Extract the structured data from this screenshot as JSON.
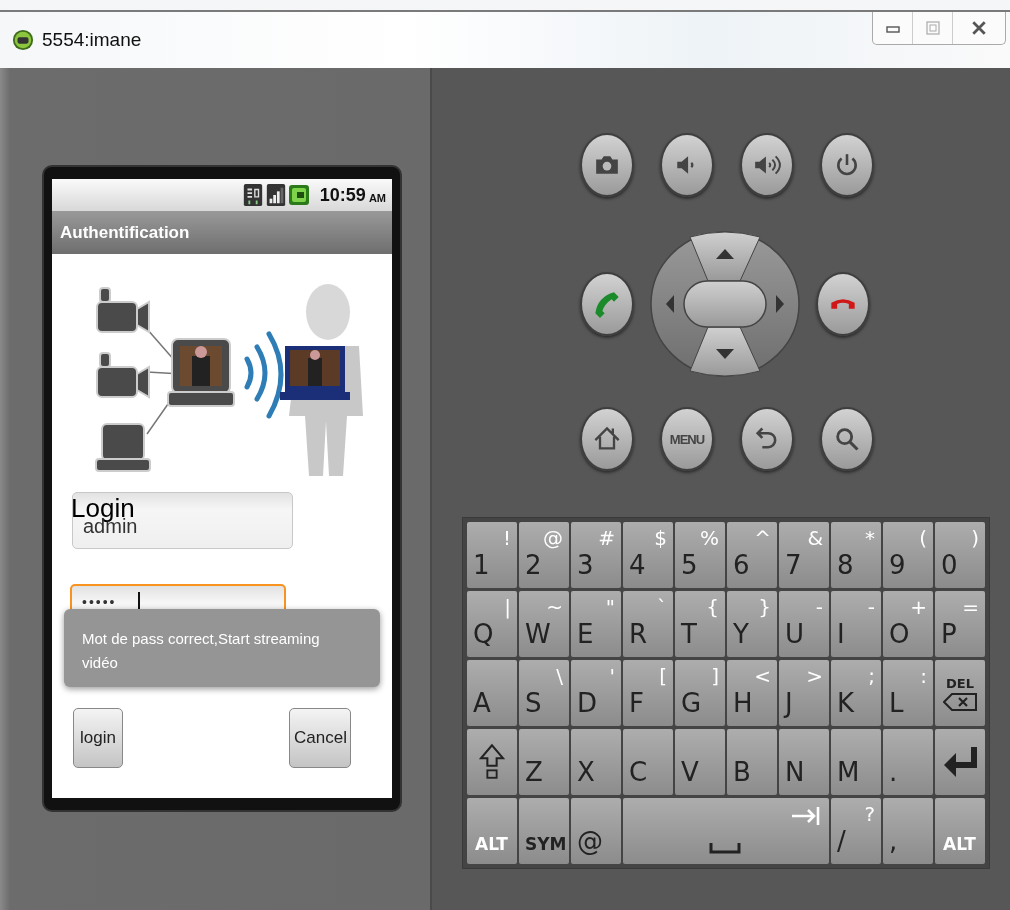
{
  "window": {
    "title": "5554:imane"
  },
  "phone": {
    "status_bar": {
      "time": "10:59",
      "period": "AM"
    },
    "app_bar": {
      "title": "Authentification"
    },
    "form": {
      "login_label": "Login",
      "username": {
        "value": "admin",
        "focused": false
      },
      "password": {
        "value": "•••••",
        "focused": true
      }
    },
    "toast": "Mot de pass correct,Start streaming vidéo",
    "buttons": [
      "login",
      "Cancel"
    ]
  },
  "hardware_buttons": [
    {
      "kind": "camera"
    },
    {
      "kind": "volume_down"
    },
    {
      "kind": "volume_up"
    },
    {
      "kind": "power"
    },
    {
      "kind": "call"
    },
    {
      "kind": "dpad"
    },
    {
      "kind": "end_call"
    },
    {
      "kind": "home"
    },
    {
      "kind": "menu",
      "label": "MENU"
    },
    {
      "kind": "back"
    },
    {
      "kind": "search"
    }
  ],
  "keyboard": [
    [
      {
        "kind": "char",
        "main": "1",
        "alt": "!"
      },
      {
        "kind": "char",
        "main": "2",
        "alt": "@"
      },
      {
        "kind": "char",
        "main": "3",
        "alt": "#"
      },
      {
        "kind": "char",
        "main": "4",
        "alt": "$"
      },
      {
        "kind": "char",
        "main": "5",
        "alt": "%"
      },
      {
        "kind": "char",
        "main": "6",
        "alt": "^"
      },
      {
        "kind": "char",
        "main": "7",
        "alt": "&"
      },
      {
        "kind": "char",
        "main": "8",
        "alt": "*"
      },
      {
        "kind": "char",
        "main": "9",
        "alt": "("
      },
      {
        "kind": "char",
        "main": "0",
        "alt": ")"
      }
    ],
    [
      {
        "kind": "char",
        "main": "Q",
        "alt": "|"
      },
      {
        "kind": "char",
        "main": "W",
        "alt": "~"
      },
      {
        "kind": "char",
        "main": "E",
        "alt": "\""
      },
      {
        "kind": "char",
        "main": "R",
        "alt": "`"
      },
      {
        "kind": "char",
        "main": "T",
        "alt": "{"
      },
      {
        "kind": "char",
        "main": "Y",
        "alt": "}"
      },
      {
        "kind": "char",
        "main": "U",
        "alt": "-"
      },
      {
        "kind": "char",
        "main": "I",
        "alt": "-"
      },
      {
        "kind": "char",
        "main": "O",
        "alt": "+"
      },
      {
        "kind": "char",
        "main": "P",
        "alt": "="
      }
    ],
    [
      {
        "kind": "char",
        "main": "A"
      },
      {
        "kind": "char",
        "main": "S",
        "alt": "\\"
      },
      {
        "kind": "char",
        "main": "D",
        "alt": "'"
      },
      {
        "kind": "char",
        "main": "F",
        "alt": "["
      },
      {
        "kind": "char",
        "main": "G",
        "alt": "]"
      },
      {
        "kind": "char",
        "main": "H",
        "alt": "<"
      },
      {
        "kind": "char",
        "main": "J",
        "alt": ">"
      },
      {
        "kind": "char",
        "main": "K",
        "alt": ";"
      },
      {
        "kind": "char",
        "main": "L",
        "alt": ":"
      },
      {
        "kind": "del",
        "label": "DEL"
      }
    ],
    [
      {
        "kind": "shift"
      },
      {
        "kind": "char",
        "main": "Z"
      },
      {
        "kind": "char",
        "main": "X"
      },
      {
        "kind": "char",
        "main": "C"
      },
      {
        "kind": "char",
        "main": "V"
      },
      {
        "kind": "char",
        "main": "B"
      },
      {
        "kind": "char",
        "main": "N"
      },
      {
        "kind": "char",
        "main": "M"
      },
      {
        "kind": "char",
        "main": "."
      },
      {
        "kind": "enter"
      }
    ],
    [
      {
        "kind": "alt",
        "label": "ALT"
      },
      {
        "kind": "sym",
        "label": "SYM"
      },
      {
        "kind": "char",
        "main": "@"
      },
      {
        "kind": "space"
      },
      {
        "kind": "char",
        "main": "/",
        "alt": "?"
      },
      {
        "kind": "char",
        "main": ","
      },
      {
        "kind": "alt",
        "label": "ALT"
      }
    ]
  ]
}
